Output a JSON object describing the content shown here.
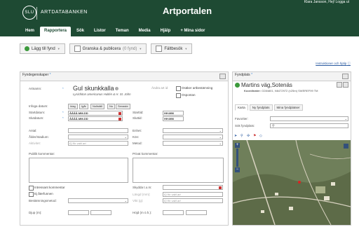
{
  "header": {
    "org_name": "ARTDATABANKEN",
    "org_mark": "SLU",
    "app_title": "Artportalen",
    "user_links": "Klara Jansson, Hej!  Logga ut"
  },
  "nav": {
    "items": [
      "Hem",
      "Rapportera",
      "Sök",
      "Listor",
      "Teman",
      "Media",
      "Hjälp",
      "+ Mina sidor"
    ],
    "active": "Rapportera"
  },
  "subbar": {
    "add_finding": "Lägg till fynd",
    "review_publish": "Granska & publicera",
    "review_count": "(0 fynd)",
    "field_visit": "Fältbesök"
  },
  "help_link": "Instruktioner och hjälp",
  "left_panel": {
    "title": "Fyndegenskaper",
    "req": "*",
    "species_label": "Artnamn:",
    "species_name": "Gul skunkkalla",
    "species_other": "Ändra art id",
    "species_latin": "Lysichiton americanus Hultén & H. St. John",
    "chk_uncertain": "Osäker artbestämning",
    "chk_unspontaneous": "Ospontan",
    "fill_date_label": "Infoga datum:",
    "date_btns": [
      "Idag",
      "Igår",
      "Nollställ",
      "Nu",
      "Senaste"
    ],
    "start_date_label": "Startdatum:",
    "end_date_label": "Slutdatum:",
    "date_placeholder": "ÅÅÅÅ-MM-DD",
    "start_time_label": "Starttid:",
    "end_time_label": "Sluttid:",
    "time_placeholder": "HH:MM",
    "count_label": "Antal:",
    "unit_label": "Enhet:",
    "age_label": "Ålder/stadium:",
    "sex_label": "Kön:",
    "activity_label": "Aktivitet:",
    "activity_placeholder": "Ej för vald art",
    "method_label": "Metod:",
    "public_comment_label": "Publik kommentar:",
    "private_comment_label": "Privat kommentar:",
    "chk_interesting": "Intressant kommentar",
    "chk_not_found": "Ej återfunnen",
    "protect_label": "Skydda t.o.m:",
    "determination_label": "Bestämningsmetod:",
    "lowest_label": "Längd (mm):",
    "weight_label": "Vikt (g):",
    "not_for_species": "Ej för vald art",
    "depth_label": "Djup (m):",
    "height_label": "Höjd (m ö.h.):"
  },
  "right_panel": {
    "title": "Fyndplats",
    "req": "*",
    "location_name": "Martins väg,Sotenäs",
    "coords_label": "Koordinater:",
    "coords_value": "O284801, N6472972 (±25m) SWEREF99 TM",
    "tabs": [
      "Karta",
      "Ny fyndplats",
      "Mina fyndplatser"
    ],
    "favorites_label": "Favoriter:",
    "search_label": "Sök fyndplats:"
  },
  "colors": {
    "brand": "#1e4a33",
    "accent": "#3c9a3c",
    "link": "#2a5aa0"
  }
}
